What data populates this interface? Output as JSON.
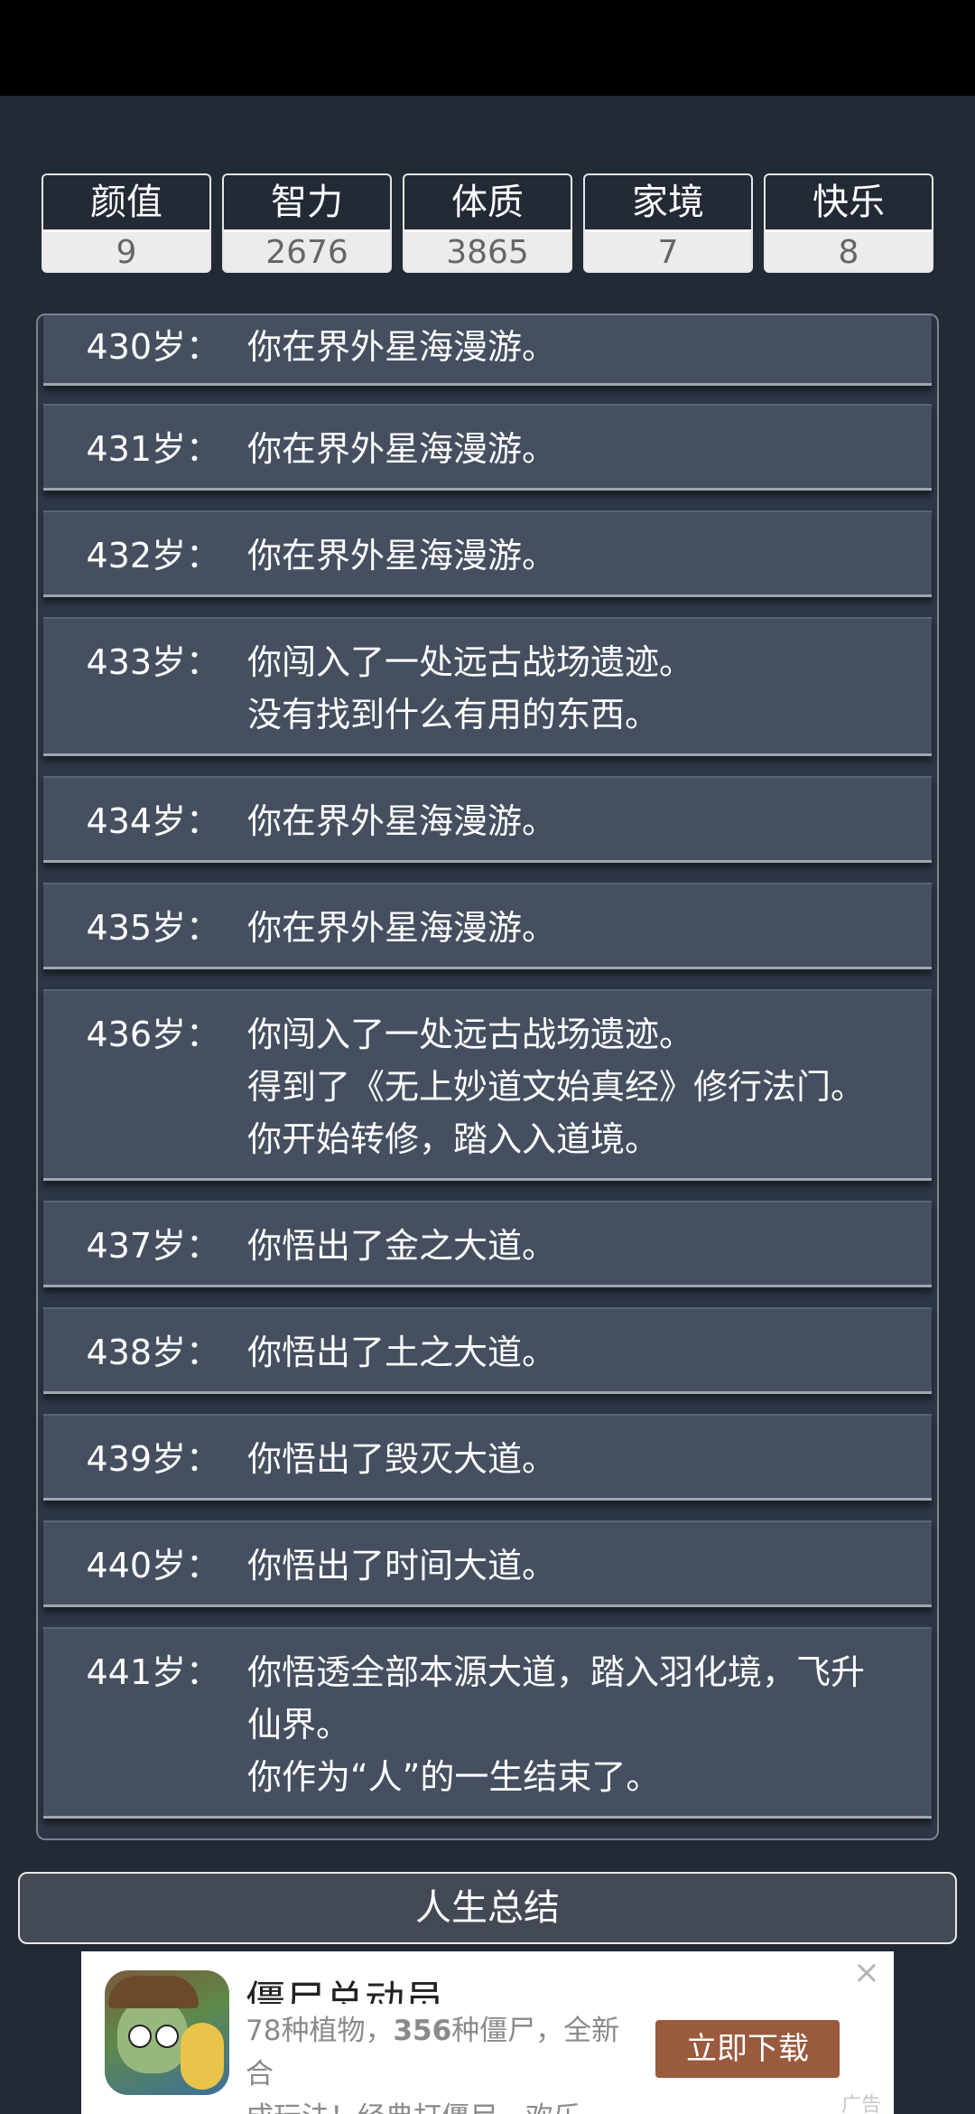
{
  "stats": [
    {
      "label": "颜值",
      "value": "9"
    },
    {
      "label": "智力",
      "value": "2676"
    },
    {
      "label": "体质",
      "value": "3865"
    },
    {
      "label": "家境",
      "value": "7"
    },
    {
      "label": "快乐",
      "value": "8"
    }
  ],
  "log": [
    {
      "age": "430岁：",
      "lines": [
        "你在界外星海漫游。"
      ]
    },
    {
      "age": "431岁：",
      "lines": [
        "你在界外星海漫游。"
      ]
    },
    {
      "age": "432岁：",
      "lines": [
        "你在界外星海漫游。"
      ]
    },
    {
      "age": "433岁：",
      "lines": [
        "你闯入了一处远古战场遗迹。",
        "没有找到什么有用的东西。"
      ]
    },
    {
      "age": "434岁：",
      "lines": [
        "你在界外星海漫游。"
      ]
    },
    {
      "age": "435岁：",
      "lines": [
        "你在界外星海漫游。"
      ]
    },
    {
      "age": "436岁：",
      "lines": [
        "你闯入了一处远古战场遗迹。",
        "得到了《无上妙道文始真经》修行法门。",
        "你开始转修，踏入入道境。"
      ]
    },
    {
      "age": "437岁：",
      "lines": [
        "你悟出了金之大道。"
      ]
    },
    {
      "age": "438岁：",
      "lines": [
        "你悟出了土之大道。"
      ]
    },
    {
      "age": "439岁：",
      "lines": [
        "你悟出了毁灭大道。"
      ]
    },
    {
      "age": "440岁：",
      "lines": [
        "你悟出了时间大道。"
      ]
    },
    {
      "age": "441岁：",
      "lines": [
        "你悟透全部本源大道，踏入羽化境，飞升",
        "仙界。",
        "你作为“人”的一生结束了。"
      ]
    }
  ],
  "summary_button": {
    "label": "人生总结"
  },
  "ad": {
    "title": "僵尸总动员",
    "desc_part1": "78种植物，",
    "desc_bold": "356",
    "desc_part2": "种僵尸，全新合",
    "desc_line2": "成玩法！经典打僵尸，欢乐再...",
    "cta": "立即下载",
    "close": "×",
    "tag": "广告"
  },
  "colors": {
    "background": "#222a36",
    "log_entry": "#454f60",
    "ad_button": "#9a5a3e"
  },
  "icons": {
    "ad_icon": "game-app-icon",
    "ad_close": "close-icon"
  }
}
